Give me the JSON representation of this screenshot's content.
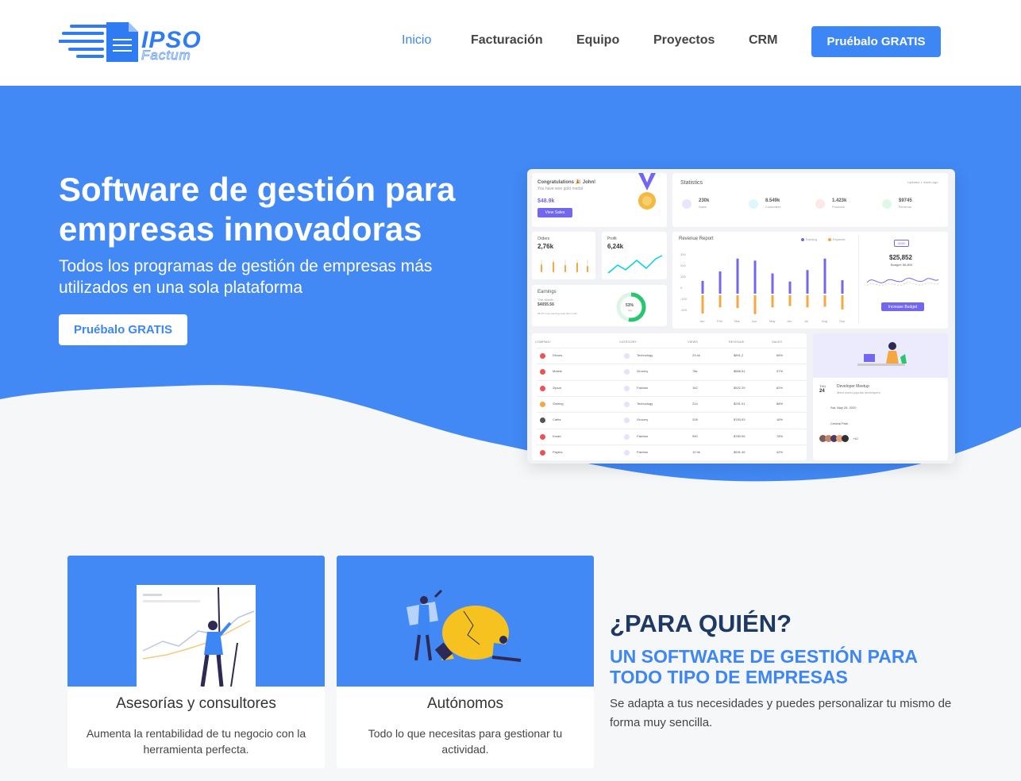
{
  "colors": {
    "primary": "#3d86f5",
    "hero_blue": "#4289f5",
    "dark_title": "#1e3a64",
    "dashboard_accent": "#7367f0",
    "dashboard_orange": "#f5a742"
  },
  "logo": {
    "main": "IPSO",
    "sub": "Factum"
  },
  "nav": {
    "items": [
      {
        "label": "Inicio",
        "active": true
      },
      {
        "label": "Facturación"
      },
      {
        "label": "Equipo"
      },
      {
        "label": "Proyectos"
      },
      {
        "label": "CRM"
      }
    ],
    "cta": "Pruébalo GRATIS"
  },
  "hero": {
    "title": "Software de gestión para empresas innovadoras",
    "subtitle": "Todos los programas de gestión de empresas más utilizados en una sola plataforma",
    "cta": "Pruébalo GRATIS"
  },
  "dashboard": {
    "congrats": {
      "title": "Congratulations 🎉 John!",
      "subtitle": "You have won gold medal",
      "value": "$48.9k",
      "button": "View Sales"
    },
    "statistics": {
      "title": "Statistics",
      "updated": "Updated 1 month ago",
      "items": [
        {
          "value": "230k",
          "label": "Sales",
          "icon": "trending-icon"
        },
        {
          "value": "8.549k",
          "label": "Customers",
          "icon": "user-icon"
        },
        {
          "value": "1.423k",
          "label": "Products",
          "icon": "box-icon"
        },
        {
          "value": "$9745",
          "label": "Revenue",
          "icon": "dollar-icon"
        }
      ]
    },
    "orders": {
      "label": "Orders",
      "value": "2,76k"
    },
    "profit": {
      "label": "Profit",
      "value": "6,24k"
    },
    "earnings": {
      "label": "Earnings",
      "period": "This Month",
      "value": "$4055.56",
      "note": "68.2% more earnings than last month",
      "percent": "53%",
      "percent_label": "App"
    },
    "revenue": {
      "title": "Revenue Report",
      "legend": [
        "Earning",
        "Expense"
      ],
      "y_ticks": [
        "300",
        "200",
        "100",
        "0",
        "-100",
        "-200"
      ],
      "months": [
        "Jan",
        "Feb",
        "Mar",
        "Apr",
        "May",
        "Jun",
        "Jul",
        "Aug",
        "Sep"
      ],
      "earning": [
        95,
        165,
        260,
        245,
        150,
        90,
        175,
        260,
        100
      ],
      "expense": [
        -135,
        -90,
        -95,
        -140,
        -90,
        -80,
        -90,
        -85,
        -105
      ]
    },
    "budget": {
      "year": "2020",
      "value": "$25,852",
      "label": "Budget: 56,800",
      "button": "Increase Budget"
    },
    "table": {
      "headers": [
        "COMPANY",
        "CATEGORY",
        "VIEWS",
        "REVENUE",
        "SALES"
      ],
      "rows": [
        {
          "company": "Dixons",
          "category": "Technology",
          "views": "23.4k",
          "revenue": "$891.2",
          "sales": "68%"
        },
        {
          "company": "Motels",
          "category": "Grocery",
          "views": "78k",
          "revenue": "$668.51",
          "sales": "97%"
        },
        {
          "company": "Zipcar",
          "category": "Fashion",
          "views": "162",
          "revenue": "$522.29",
          "sales": "62%"
        },
        {
          "company": "Owning",
          "category": "Technology",
          "views": "214",
          "revenue": "$291.01",
          "sales": "88%"
        },
        {
          "company": "Cafés",
          "category": "Grocery",
          "views": "208",
          "revenue": "$783.93",
          "sales": "16%"
        },
        {
          "company": "Kmart",
          "category": "Fashion",
          "views": "990",
          "revenue": "$780.05",
          "sales": "78%"
        },
        {
          "company": "Payers",
          "category": "Fashion",
          "views": "12.9k",
          "revenue": "$531.49",
          "sales": "42%"
        }
      ]
    },
    "meetup": {
      "day": "THU",
      "date": "24",
      "title": "Developer Meetup",
      "subtitle": "Meet world popular developers",
      "when": "Sat, May 25, 2020",
      "place": "Central Park",
      "more": "+42"
    }
  },
  "features": [
    {
      "title": "Asesorías y consultores",
      "desc": "Aumenta la rentabilidad de tu negocio con la herramienta perfecta."
    },
    {
      "title": "Autónomos",
      "desc": "Todo lo que necesitas para gestionar tu actividad."
    }
  ],
  "para_quien": {
    "title": "¿PARA QUIÉN?",
    "subtitle": "UN SOFTWARE DE GESTIÓN PARA TODO TIPO DE EMPRESAS",
    "desc": "Se adapta a tus necesidades y puedes personalizar tu mismo de forma muy sencilla."
  }
}
